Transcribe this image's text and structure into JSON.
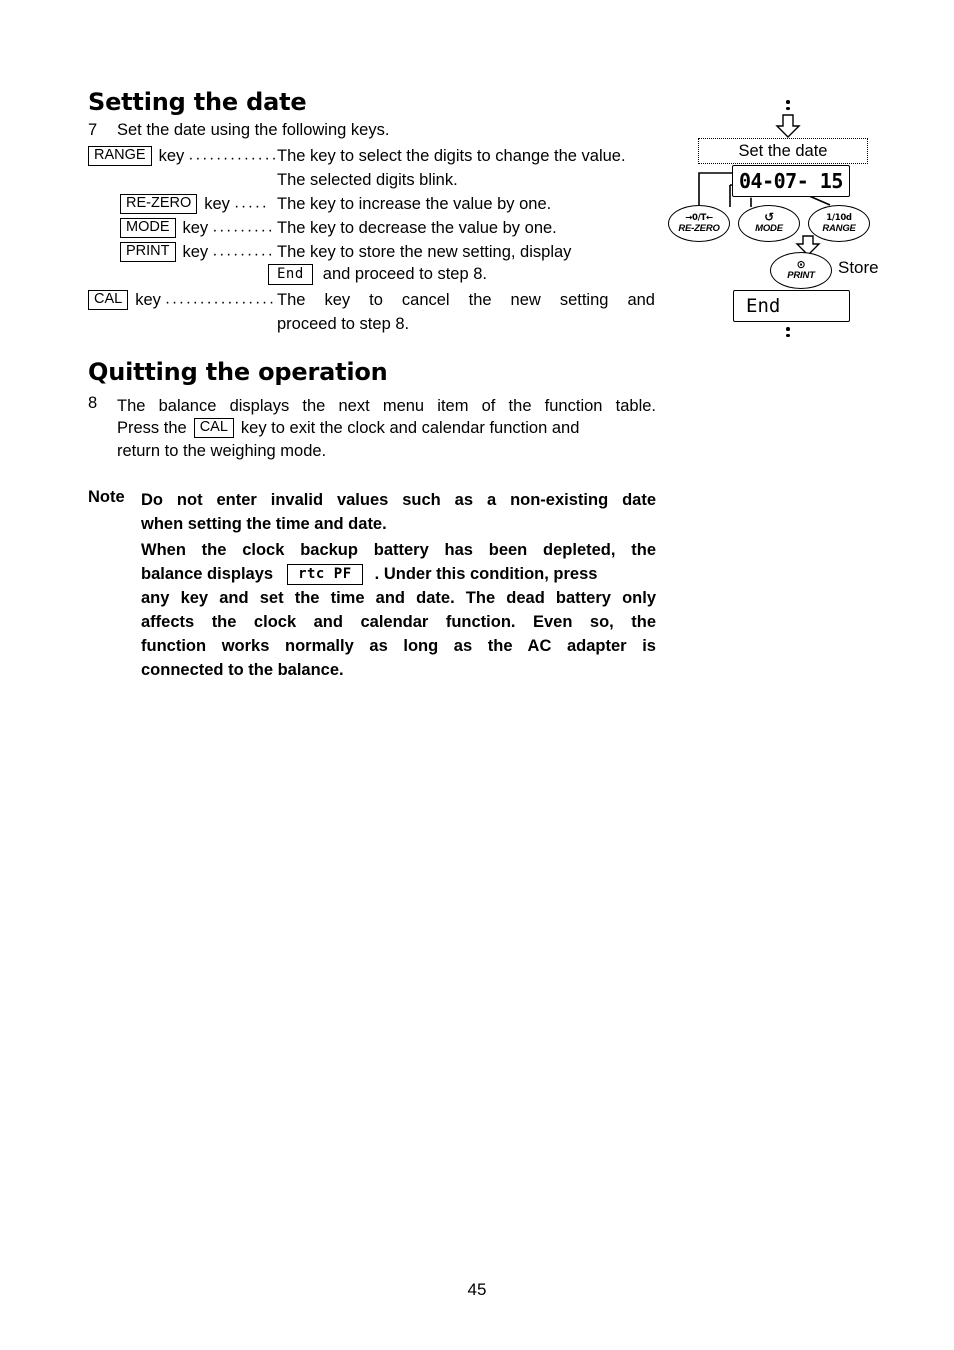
{
  "document": {
    "page_number": "45"
  },
  "sections": {
    "setting_date": {
      "heading": "Setting the date",
      "step_number": "7",
      "step_text": "Set the date using the following keys.",
      "keys": [
        {
          "key_label": "RANGE",
          "key_word": "key",
          "leader": "·············",
          "description": "The key to select the digits to change the value.",
          "description_line2": "The selected digits blink."
        },
        {
          "key_label": "RE-ZERO",
          "key_word": "key",
          "leader": "·····",
          "description": "The key to increase the value by one."
        },
        {
          "key_label": "MODE",
          "key_word": "key",
          "leader": "··········",
          "description": "The key to decrease the value by one."
        },
        {
          "key_label": "PRINT",
          "key_word": "key",
          "leader": "··········",
          "description": "The key to store the new setting, display",
          "lcd_inline": "End",
          "description_after_lcd": "and proceed to step 8."
        },
        {
          "key_label": "CAL",
          "key_word": "key",
          "leader": "··················",
          "description": "The key to cancel the new setting and",
          "description_line2": "proceed to step 8."
        }
      ]
    },
    "quitting_operation": {
      "heading": "Quitting the operation",
      "step_number": "8",
      "line1": "The balance displays the next menu item of the function table.",
      "line2_before": "Press the",
      "line2_key": "CAL",
      "line2_after": "key to exit the clock and calendar function and",
      "line3": "return to the weighing mode."
    },
    "note": {
      "label": "Note",
      "line1": "Do not enter invalid values such as a non-existing date",
      "line2": "when setting the time and date.",
      "line3": "When the clock backup battery has been depleted, the",
      "line4_before": "balance displays",
      "line4_lcd": "rtc PF",
      "line4_after": ". Under this condition, press",
      "line5": "any key and set the time and date. The dead battery only",
      "line6": "affects the clock and calendar function. Even so, the",
      "line7": "function works normally as long as the AC adapter is",
      "line8": "connected to the balance."
    }
  },
  "diagram": {
    "set_date_box": "Set the date",
    "lcd_date_value": "04-07- 15",
    "lcd_end_value": "End",
    "store_label": "Store",
    "buttons": [
      {
        "glyph": "→0/T←",
        "name": "RE-ZERO"
      },
      {
        "glyph": "↺",
        "name": "MODE"
      },
      {
        "glyph": "1/10d",
        "name": "RANGE"
      },
      {
        "glyph": "⊙",
        "name": "PRINT"
      }
    ]
  }
}
